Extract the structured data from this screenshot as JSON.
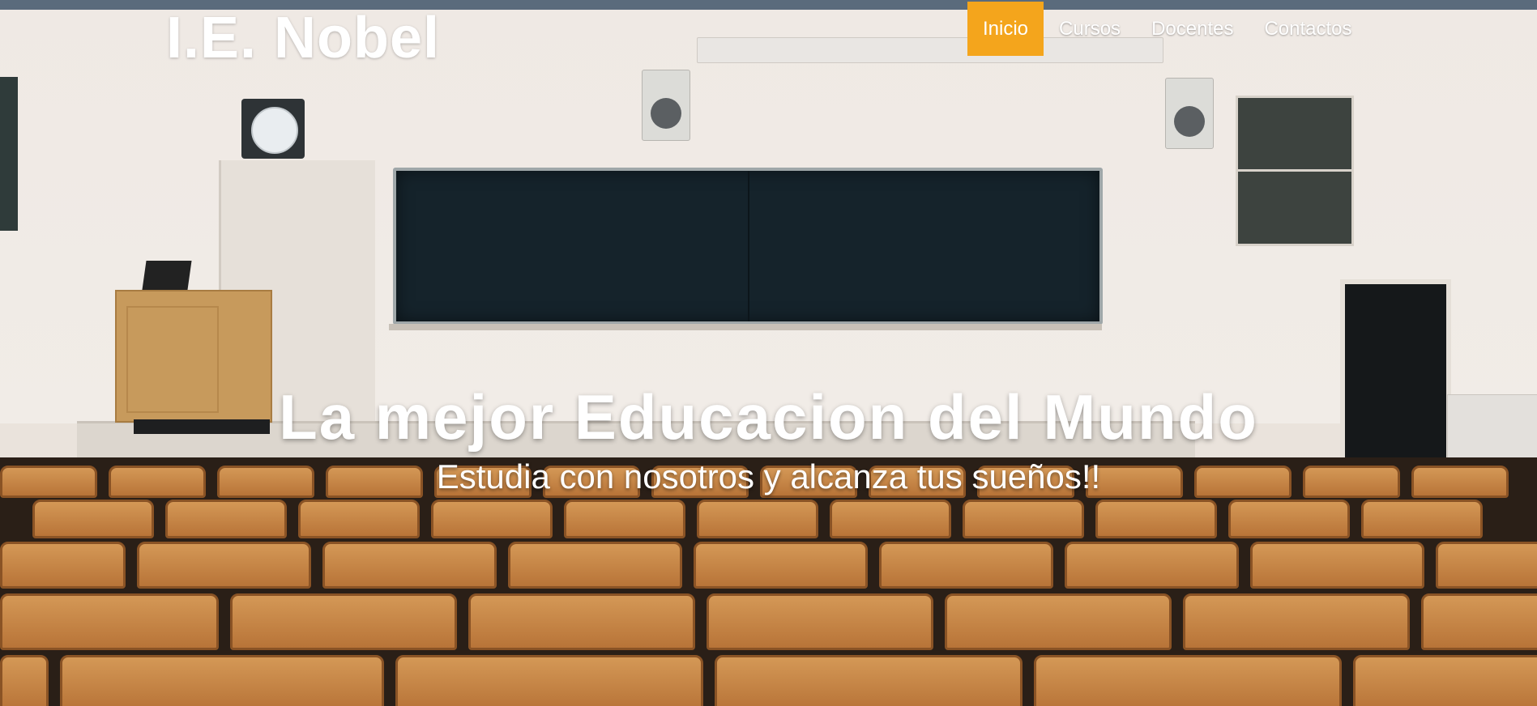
{
  "site": {
    "logo": "I.E. Nobel"
  },
  "nav": {
    "items": [
      {
        "label": "Inicio",
        "active": true
      },
      {
        "label": "Cursos",
        "active": false
      },
      {
        "label": "Docentes",
        "active": false
      },
      {
        "label": "Contactos",
        "active": false
      }
    ],
    "active_color": "#f4a51c"
  },
  "hero": {
    "title": "La mejor Educacion del Mundo",
    "subtitle": "Estudia con nosotros y alcanza tus sueños!!",
    "background_image": "classroom-lecture-hall-photo"
  }
}
